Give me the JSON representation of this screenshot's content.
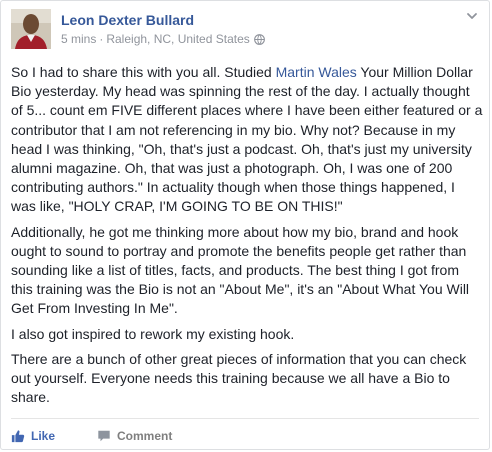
{
  "post": {
    "author": "Leon Dexter Bullard",
    "time": "5 mins",
    "separator": "·",
    "location": "Raleigh, NC, United States",
    "privacy_icon": "globe-icon",
    "options_icon": "chevron-down-icon",
    "paragraph1_pre": "So I had to share this with you all. Studied ",
    "paragraph1_link": "Martin Wales",
    "paragraph1_post": " Your Million Dollar Bio yesterday. My head was spinning the rest of the day. I actually thought of 5... count em FIVE different places where I have been either featured or a contributor that I am not referencing in my bio. Why not? Because in my head I was thinking, \"Oh, that's just a podcast. Oh, that's just my university alumni magazine. Oh, that was just a photograph. Oh, I was one of 200 contributing authors.\" In actuality though when those things happened, I was like, \"HOLY CRAP, I'M GOING TO BE ON THIS!\"",
    "paragraph2": "Additionally, he got me thinking more about how my bio, brand and hook ought to sound to portray and promote the benefits people get rather than sounding like a list of titles, facts, and products. The best thing I got from this training was the Bio is not an \"About Me\", it's an \"About What You Will Get From Investing In Me\".",
    "paragraph3": "I also got inspired to rework my existing hook.",
    "paragraph4": "There are a bunch of other great pieces of information that you can check out yourself. Everyone needs this training because we all have a Bio to share."
  },
  "actions": {
    "like_label": "Like",
    "like_icon": "thumbs-up-icon",
    "comment_label": "Comment",
    "comment_icon": "comment-icon"
  },
  "colors": {
    "link": "#365899",
    "like": "#4267b2",
    "meta": "#90949c",
    "text": "#1d2129"
  }
}
